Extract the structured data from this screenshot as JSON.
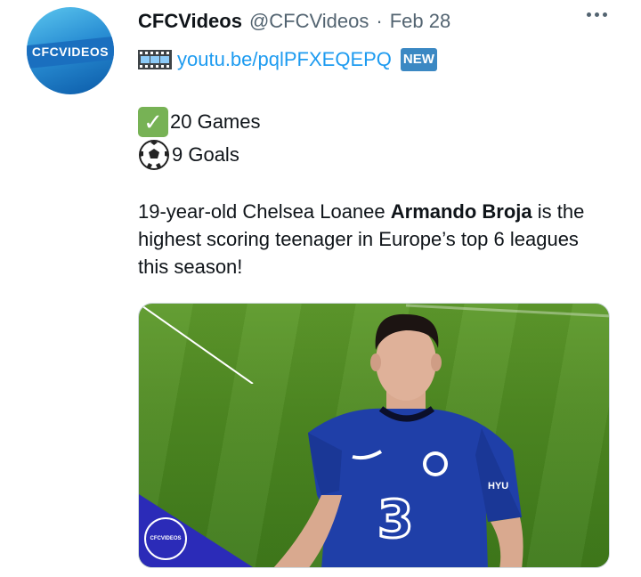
{
  "account": {
    "avatar_text": "CFCVIDEOS",
    "display_name": "CFCVideos",
    "handle": "@CFCVideos",
    "separator": "·",
    "date": "Feb 28"
  },
  "tweet": {
    "link_icon": "film-frames-icon",
    "link_text": "youtu.be/pqlPFXEQEPQ",
    "new_badge": "NEW",
    "stat_games": "20 Games",
    "stat_goals": "9 Goals",
    "text_before": "19-year-old Chelsea Loanee ",
    "text_bold": "Armando Broja",
    "text_after": " is the highest scoring teenager in Europe’s top 6 leagues this season!"
  },
  "media": {
    "watermark": "CFCVIDEOS",
    "shirt_text": "HYU"
  },
  "colors": {
    "link": "#1d9bf0",
    "secondary_text": "#536471",
    "check_green": "#77b255",
    "new_blue": "#3b88c3"
  }
}
